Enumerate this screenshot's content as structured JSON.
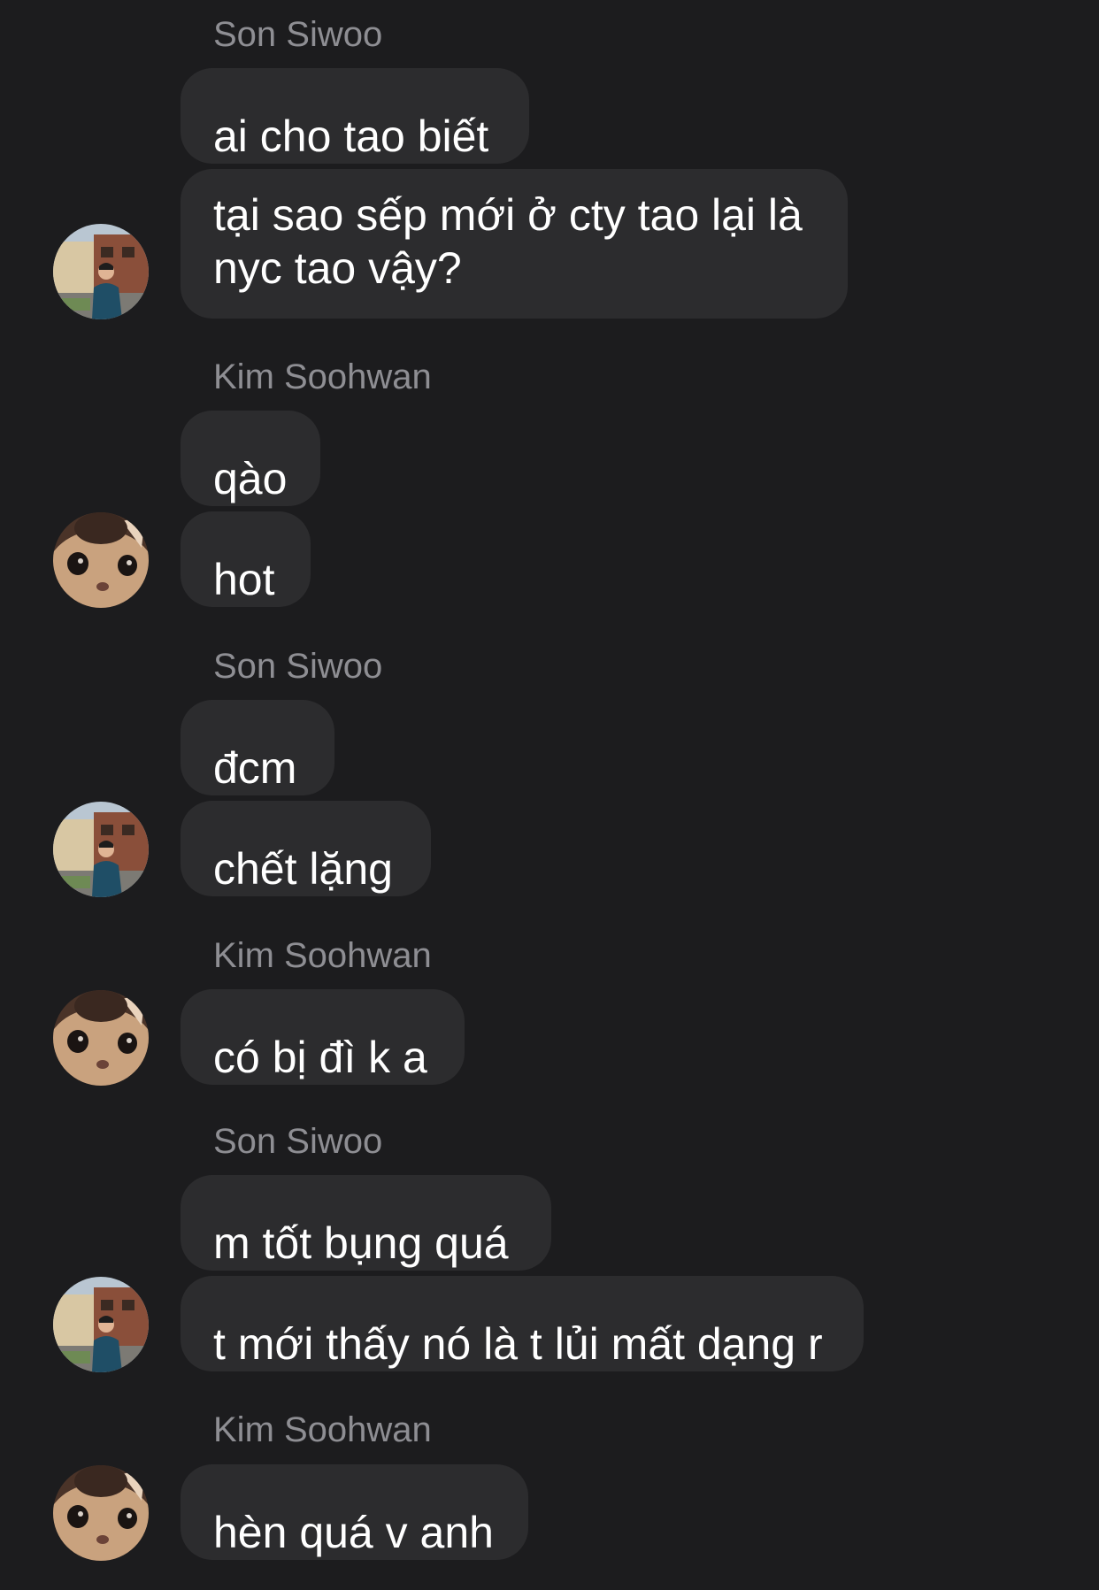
{
  "groups": [
    {
      "sender": "Son Siwoo",
      "avatar": "person-street-avatar",
      "messages": [
        "ai cho tao biết",
        "tại sao sếp mới ở cty tao lại là nyc tao vậy?"
      ]
    },
    {
      "sender": "Kim Soohwan",
      "avatar": "cat-face-avatar",
      "messages": [
        "qào",
        "hot"
      ]
    },
    {
      "sender": "Son Siwoo",
      "avatar": "person-street-avatar",
      "messages": [
        "đcm",
        "chết lặng"
      ]
    },
    {
      "sender": "Kim Soohwan",
      "avatar": "cat-face-avatar",
      "messages": [
        "có bị đì k a"
      ]
    },
    {
      "sender": "Son Siwoo",
      "avatar": "person-street-avatar",
      "messages": [
        "m tốt bụng quá",
        "t mới thấy nó là t lủi mất dạng r"
      ]
    },
    {
      "sender": "Kim Soohwan",
      "avatar": "cat-face-avatar",
      "messages": [
        "hèn quá v anh"
      ]
    }
  ],
  "colors": {
    "background": "#1c1c1e",
    "bubble": "#2c2c2e",
    "sender_text": "#8e8e93",
    "message_text": "#ffffff"
  }
}
